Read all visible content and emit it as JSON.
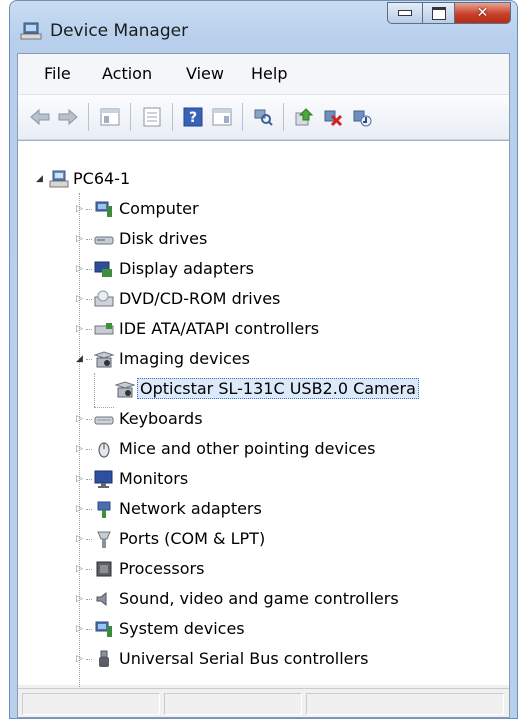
{
  "window": {
    "title": "Device Manager"
  },
  "menu": {
    "items": [
      "File",
      "Action",
      "View",
      "Help"
    ]
  },
  "toolbar": {
    "icons": [
      "back-icon",
      "forward-icon",
      "show-hide-tree-icon",
      "properties-icon",
      "help-icon",
      "action-pane-icon",
      "scan-hardware-icon",
      "update-driver-icon",
      "uninstall-icon",
      "enable-device-icon"
    ]
  },
  "tree": {
    "root": "PC64-1",
    "categories": [
      {
        "label": "Computer",
        "icon": "computer-icon",
        "expanded": false
      },
      {
        "label": "Disk drives",
        "icon": "disk-drive-icon",
        "expanded": false
      },
      {
        "label": "Display adapters",
        "icon": "display-adapter-icon",
        "expanded": false
      },
      {
        "label": "DVD/CD-ROM drives",
        "icon": "dvd-drive-icon",
        "expanded": false
      },
      {
        "label": "IDE ATA/ATAPI controllers",
        "icon": "ide-controller-icon",
        "expanded": false
      },
      {
        "label": "Imaging devices",
        "icon": "camera-icon",
        "expanded": true,
        "children": [
          "Opticstar SL-131C USB2.0 Camera"
        ]
      },
      {
        "label": "Keyboards",
        "icon": "keyboard-icon",
        "expanded": false
      },
      {
        "label": "Mice and other pointing devices",
        "icon": "mouse-icon",
        "expanded": false
      },
      {
        "label": "Monitors",
        "icon": "monitor-icon",
        "expanded": false
      },
      {
        "label": "Network adapters",
        "icon": "network-adapter-icon",
        "expanded": false
      },
      {
        "label": "Ports (COM & LPT)",
        "icon": "port-icon",
        "expanded": false
      },
      {
        "label": "Processors",
        "icon": "processor-icon",
        "expanded": false
      },
      {
        "label": "Sound, video and game controllers",
        "icon": "sound-icon",
        "expanded": false
      },
      {
        "label": "System devices",
        "icon": "system-device-icon",
        "expanded": false
      },
      {
        "label": "Universal Serial Bus controllers",
        "icon": "usb-icon",
        "expanded": false
      }
    ]
  }
}
